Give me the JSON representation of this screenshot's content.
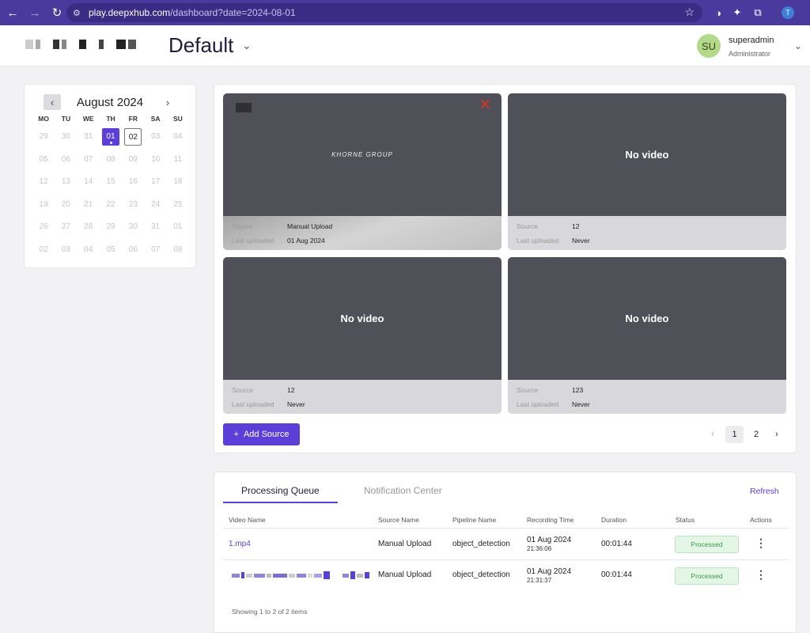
{
  "browser": {
    "url_host": "play.deepxhub.com",
    "url_path": "/dashboard?date=2024-08-01",
    "profile_initial": "T"
  },
  "header": {
    "workspace_name": "Default",
    "user": {
      "initials": "SU",
      "name": "superadmin",
      "role": "Administrator"
    }
  },
  "calendar": {
    "month_label": "August 2024",
    "weekdays": [
      "MO",
      "TU",
      "WE",
      "TH",
      "FR",
      "SA",
      "SU"
    ],
    "weeks": [
      [
        "29",
        "30",
        "31",
        "01",
        "02",
        "03",
        "04"
      ],
      [
        "05",
        "06",
        "07",
        "08",
        "09",
        "10",
        "11"
      ],
      [
        "12",
        "13",
        "14",
        "15",
        "16",
        "17",
        "18"
      ],
      [
        "19",
        "20",
        "21",
        "22",
        "23",
        "24",
        "25"
      ],
      [
        "26",
        "27",
        "28",
        "29",
        "30",
        "31",
        "01"
      ],
      [
        "02",
        "03",
        "04",
        "05",
        "06",
        "07",
        "08"
      ]
    ],
    "selected_day": "01",
    "active_day": "02"
  },
  "sources": {
    "labels": {
      "source": "Source",
      "last_uploaded": "Last uploaded"
    },
    "no_video_text": "No video",
    "watermark": "KHORNE GROUP",
    "tiles": [
      {
        "source": "Manual Upload",
        "last_uploaded": "01 Aug 2024",
        "has_video": true
      },
      {
        "source": "12",
        "last_uploaded": "Never",
        "has_video": false
      },
      {
        "source": "12",
        "last_uploaded": "Never",
        "has_video": false
      },
      {
        "source": "123",
        "last_uploaded": "Never",
        "has_video": false
      }
    ],
    "add_source_label": "Add Source",
    "pages": [
      "1",
      "2"
    ],
    "current_page": "1"
  },
  "queue": {
    "tabs": [
      "Processing Queue",
      "Notification Center"
    ],
    "active_tab": "Processing Queue",
    "refresh_label": "Refresh",
    "columns": [
      "Video Name",
      "Source Name",
      "Pipeline Name",
      "Recording Time",
      "Duration",
      "Status",
      "Actions"
    ],
    "rows": [
      {
        "video_name": "1.mp4",
        "source_name": "Manual Upload",
        "pipeline": "object_detection",
        "rec_date": "01 Aug 2024",
        "rec_time": "21:36:06",
        "duration": "00:01:44",
        "status": "Processed"
      },
      {
        "video_name": "",
        "source_name": "Manual Upload",
        "pipeline": "object_detection",
        "rec_date": "01 Aug 2024",
        "rec_time": "21:31:37",
        "duration": "00:01:44",
        "status": "Processed"
      }
    ],
    "footer": "Showing 1 to 2 of 2 items"
  },
  "colors": {
    "accent": "#5b3fd8",
    "browser_chrome": "#4b3a9e",
    "status_green": "#3b9a4a"
  }
}
